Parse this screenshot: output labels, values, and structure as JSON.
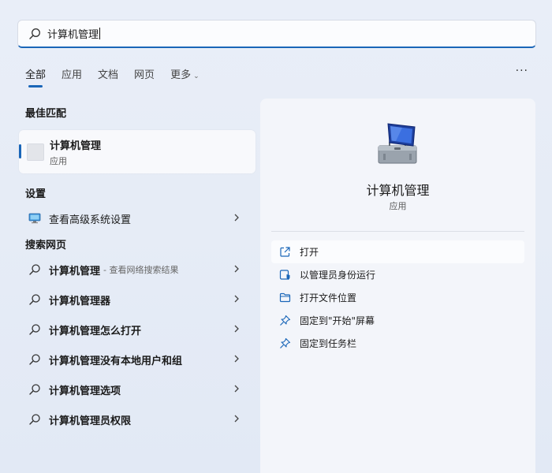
{
  "search": {
    "value": "计算机管理",
    "icon": "search-icon"
  },
  "tabs": [
    {
      "label": "全部"
    },
    {
      "label": "应用"
    },
    {
      "label": "文档"
    },
    {
      "label": "网页"
    },
    {
      "label": "更多"
    }
  ],
  "more_menu": "···",
  "best_match": {
    "heading": "最佳匹配",
    "title": "计算机管理",
    "subtitle": "应用"
  },
  "settings": {
    "heading": "设置",
    "item": "查看高级系统设置"
  },
  "web": {
    "heading": "搜索网页",
    "items": [
      {
        "label": "计算机管理",
        "sub": "- 查看网络搜索结果"
      },
      {
        "label": "计算机管理器"
      },
      {
        "label": "计算机管理怎么打开"
      },
      {
        "label": "计算机管理没有本地用户和组"
      },
      {
        "label": "计算机管理选项"
      },
      {
        "label": "计算机管理员权限"
      }
    ]
  },
  "detail": {
    "title": "计算机管理",
    "subtitle": "应用",
    "actions": [
      {
        "label": "打开",
        "icon": "open-external-icon"
      },
      {
        "label": "以管理员身份运行",
        "icon": "shield-admin-icon"
      },
      {
        "label": "打开文件位置",
        "icon": "folder-icon"
      },
      {
        "label": "固定到\"开始\"屏幕",
        "icon": "pin-icon"
      },
      {
        "label": "固定到任务栏",
        "icon": "pin-icon"
      }
    ]
  },
  "colors": {
    "accent": "#1a66b8",
    "panel": "#f3f5fa"
  }
}
